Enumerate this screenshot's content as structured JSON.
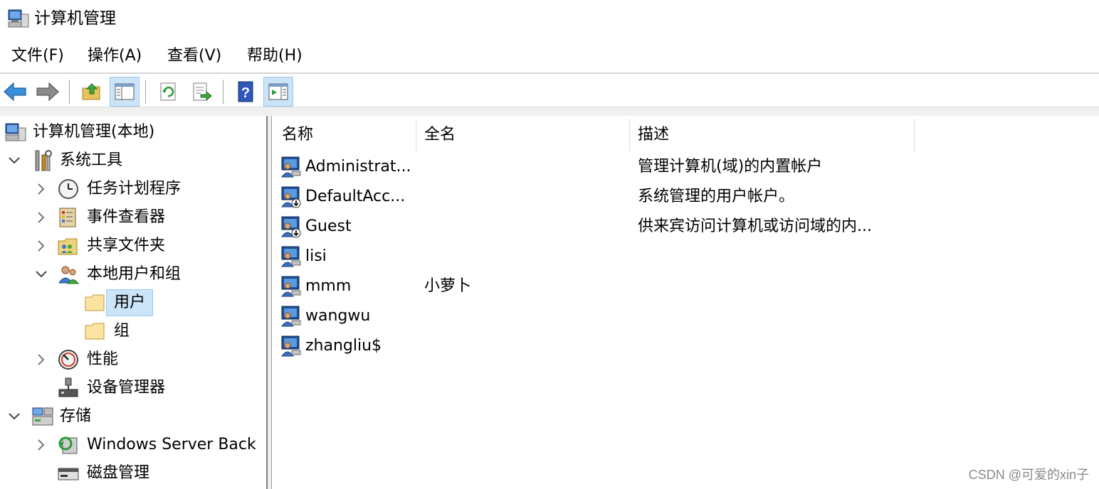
{
  "window": {
    "title": "计算机管理",
    "icon": "computer-management-icon"
  },
  "menu": [
    {
      "label": "文件(F)"
    },
    {
      "label": "操作(A)"
    },
    {
      "label": "查看(V)"
    },
    {
      "label": "帮助(H)"
    }
  ],
  "toolbar": [
    {
      "icon": "back-arrow-icon"
    },
    {
      "icon": "forward-arrow-icon"
    },
    {
      "icon": "up-folder-icon"
    },
    {
      "icon": "show-hide-console-tree-icon",
      "active": true
    },
    {
      "icon": "refresh-icon"
    },
    {
      "icon": "export-list-icon"
    },
    {
      "icon": "help-icon"
    },
    {
      "icon": "show-hide-action-pane-icon",
      "active": true
    }
  ],
  "tree": [
    {
      "label": "计算机管理(本地)",
      "icon": "computer-management-icon",
      "expander": "none"
    },
    {
      "label": "系统工具",
      "icon": "tools-icon",
      "expander": "expanded"
    },
    {
      "label": "任务计划程序",
      "icon": "clock-icon",
      "expander": "collapsed"
    },
    {
      "label": "事件查看器",
      "icon": "event-viewer-icon",
      "expander": "collapsed"
    },
    {
      "label": "共享文件夹",
      "icon": "shared-folder-icon",
      "expander": "collapsed"
    },
    {
      "label": "本地用户和组",
      "icon": "users-group-icon",
      "expander": "expanded"
    },
    {
      "label": "用户",
      "icon": "folder-icon",
      "expander": "none",
      "selected": true
    },
    {
      "label": "组",
      "icon": "folder-icon",
      "expander": "none"
    },
    {
      "label": "性能",
      "icon": "performance-icon",
      "expander": "collapsed"
    },
    {
      "label": "设备管理器",
      "icon": "device-manager-icon",
      "expander": "none"
    },
    {
      "label": "存储",
      "icon": "storage-icon",
      "expander": "expanded"
    },
    {
      "label": "Windows Server Back",
      "icon": "backup-icon",
      "expander": "collapsed"
    },
    {
      "label": "磁盘管理",
      "icon": "disk-icon",
      "expander": "none"
    }
  ],
  "columns": [
    {
      "label": "名称"
    },
    {
      "label": "全名"
    },
    {
      "label": "描述"
    }
  ],
  "users": [
    {
      "name": "Administrat...",
      "fullname": "",
      "description": "管理计算机(域)的内置帐户",
      "disabled": false
    },
    {
      "name": "DefaultAcc...",
      "fullname": "",
      "description": "系统管理的用户帐户。",
      "disabled": true
    },
    {
      "name": "Guest",
      "fullname": "",
      "description": "供来宾访问计算机或访问域的内...",
      "disabled": true
    },
    {
      "name": "lisi",
      "fullname": "",
      "description": "",
      "disabled": false
    },
    {
      "name": "mmm",
      "fullname": "小萝卜",
      "description": "",
      "disabled": false
    },
    {
      "name": "wangwu",
      "fullname": "",
      "description": "",
      "disabled": false
    },
    {
      "name": "zhangliu$",
      "fullname": "",
      "description": "",
      "disabled": false
    }
  ],
  "watermark": "CSDN @可爱的xin子",
  "colors": {
    "selection": "#cce4f7",
    "selection_border": "#99c9ef",
    "separator": "#d6d6d6"
  }
}
